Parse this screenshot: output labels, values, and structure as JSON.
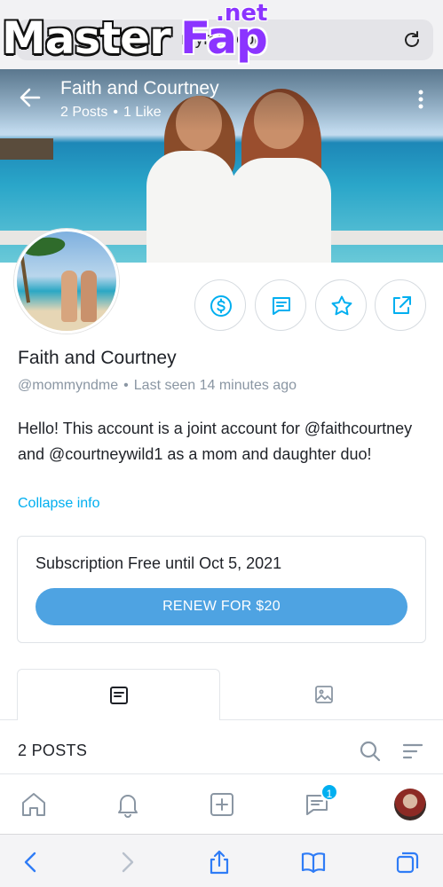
{
  "browser": {
    "url_text": "mymm.com",
    "watermark": {
      "left": "Master",
      "right": "Fap",
      "suffix": ".net"
    }
  },
  "profile": {
    "cover_title": "Faith and Courtney",
    "posts_stat": "2 Posts",
    "likes_stat": "1 Like",
    "stats_separator": "•",
    "display_name": "Faith and Courtney",
    "handle": "@mommyndme",
    "handle_separator": "•",
    "last_seen": "Last seen 14 minutes ago",
    "bio": "Hello! This account is a joint account for @faithcourtney and @courtneywild1 as a mom and daughter duo!",
    "collapse_label": "Collapse info"
  },
  "actions": [
    {
      "icon": "dollar-icon"
    },
    {
      "icon": "message-icon"
    },
    {
      "icon": "star-icon"
    },
    {
      "icon": "share-icon"
    }
  ],
  "subscription": {
    "title": "Subscription Free until Oct 5, 2021",
    "renew_label": "RENEW FOR $20"
  },
  "tabs": [
    {
      "icon": "posts-icon",
      "active": true
    },
    {
      "icon": "media-icon",
      "active": false
    }
  ],
  "posts_header": {
    "label": "2 POSTS"
  },
  "app_nav": {
    "items": [
      "home-icon",
      "bell-icon",
      "add-icon",
      "messages-icon",
      "profile-avatar"
    ],
    "messages_badge": "1"
  },
  "browser_toolbar": {
    "items": [
      "back-icon",
      "forward-icon",
      "share-icon",
      "bookmarks-icon",
      "tabs-icon"
    ]
  },
  "colors": {
    "accent": "#00aff0",
    "button": "#4ea3e2",
    "muted_text": "#8a96a3"
  }
}
